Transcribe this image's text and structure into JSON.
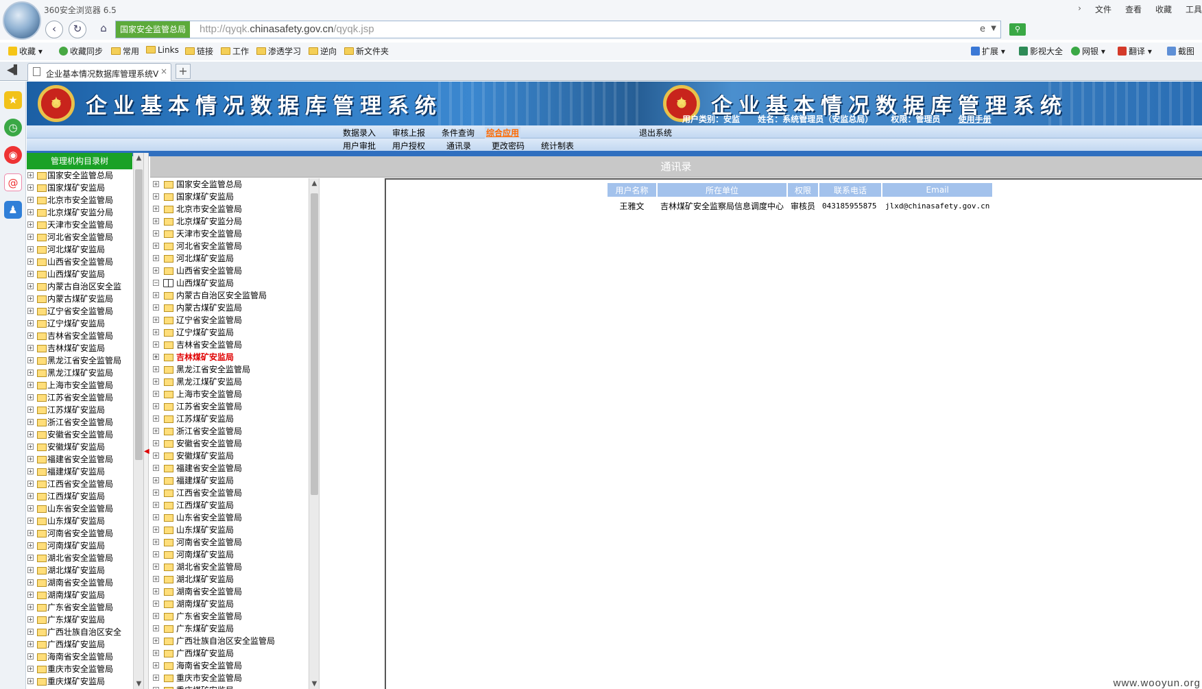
{
  "browser": {
    "name": "360安全浏览器 6.5",
    "window_menu": [
      "文件",
      "查看",
      "收藏",
      "工具"
    ],
    "site_tag": "国家安全监管总局",
    "url_prefix": "http://qyqk.",
    "url_domain": "chinasafety.gov.cn",
    "url_path": "/qyqk.jsp",
    "bookmarks": [
      "收藏",
      "收藏同步",
      "常用",
      "Links",
      "链接",
      "工作",
      "渗透学习",
      "逆向",
      "新文件夹"
    ],
    "bookmark_tools": [
      "扩展",
      "影视大全",
      "网银",
      "翻译",
      "截图"
    ],
    "tab_title": "企业基本情况数据库管理系统V",
    "tab_close": "×",
    "new_tab": "+"
  },
  "app": {
    "title": "企业基本情况数据库管理系统",
    "user_type": "用户类别：安监",
    "user_name": "姓名：系统管理员（安监总局）",
    "permission": "权限：管理员",
    "manual_link": "使用手册",
    "menu_row1": [
      "数据录入",
      "审核上报",
      "条件查询",
      "综合应用",
      "退出系统"
    ],
    "active_menu": "综合应用",
    "menu_row2": [
      "用户审批",
      "用户授权",
      "通讯录",
      "更改密码",
      "统计制表"
    ]
  },
  "left_tree": {
    "header": "管理机构目录树",
    "items": [
      "国家安全监管总局",
      "国家煤矿安监局",
      "北京市安全监管局",
      "北京煤矿安监分局",
      "天津市安全监管局",
      "河北省安全监管局",
      "河北煤矿安监局",
      "山西省安全监管局",
      "山西煤矿安监局",
      "内蒙古自治区安全监",
      "内蒙古煤矿安监局",
      "辽宁省安全监管局",
      "辽宁煤矿安监局",
      "吉林省安全监管局",
      "吉林煤矿安监局",
      "黑龙江省安全监管局",
      "黑龙江煤矿安监局",
      "上海市安全监管局",
      "江苏省安全监管局",
      "江苏煤矿安监局",
      "浙江省安全监管局",
      "安徽省安全监管局",
      "安徽煤矿安监局",
      "福建省安全监管局",
      "福建煤矿安监局",
      "江西省安全监管局",
      "江西煤矿安监局",
      "山东省安全监管局",
      "山东煤矿安监局",
      "河南省安全监管局",
      "河南煤矿安监局",
      "湖北省安全监管局",
      "湖北煤矿安监局",
      "湖南省安全监管局",
      "湖南煤矿安监局",
      "广东省安全监管局",
      "广东煤矿安监局",
      "广西壮族自治区安全",
      "广西煤矿安监局",
      "海南省安全监管局",
      "重庆市安全监管局",
      "重庆煤矿安监局"
    ]
  },
  "content": {
    "title": "通讯录",
    "mid_tree": [
      "国家安全监管总局",
      "国家煤矿安监局",
      "北京市安全监管局",
      "北京煤矿安监分局",
      "天津市安全监管局",
      "河北省安全监管局",
      "河北煤矿安监局",
      "山西省安全监管局",
      "山西煤矿安监局",
      "内蒙古自治区安全监管局",
      "内蒙古煤矿安监局",
      "辽宁省安全监管局",
      "辽宁煤矿安监局",
      "吉林省安全监管局",
      "吉林煤矿安监局",
      "黑龙江省安全监管局",
      "黑龙江煤矿安监局",
      "上海市安全监管局",
      "江苏省安全监管局",
      "江苏煤矿安监局",
      "浙江省安全监管局",
      "安徽省安全监管局",
      "安徽煤矿安监局",
      "福建省安全监管局",
      "福建煤矿安监局",
      "江西省安全监管局",
      "江西煤矿安监局",
      "山东省安全监管局",
      "山东煤矿安监局",
      "河南省安全监管局",
      "河南煤矿安监局",
      "湖北省安全监管局",
      "湖北煤矿安监局",
      "湖南省安全监管局",
      "湖南煤矿安监局",
      "广东省安全监管局",
      "广东煤矿安监局",
      "广西壮族自治区安全监管局",
      "广西煤矿安监局",
      "海南省安全监管局",
      "重庆市安全监管局",
      "重庆煤矿安监局"
    ],
    "expanded_item": "山西煤矿安监局",
    "selected_item": "吉林煤矿安监局",
    "table": {
      "headers": [
        "用户名称",
        "所在单位",
        "权限",
        "联系电话",
        "Email"
      ],
      "rows": [
        [
          "王雅文",
          "吉林煤矿安全监察局信息调度中心",
          "审核员",
          "043185955875",
          "jlxd@chinasafety.gov.cn"
        ]
      ]
    }
  },
  "watermark": "www.wooyun.org",
  "colors": {
    "banner_blue": "#2f7cc4",
    "tree_header_green": "#1aa126",
    "active_menu_orange": "#ff6a00",
    "selected_red": "#e00000",
    "table_header_blue": "#a3c2ec",
    "site_tag_green": "#5caa3a"
  },
  "icons": {
    "app_sidebar": [
      "star-icon",
      "clock-icon",
      "weibo-icon",
      "mail-icon",
      "qq-icon"
    ]
  }
}
